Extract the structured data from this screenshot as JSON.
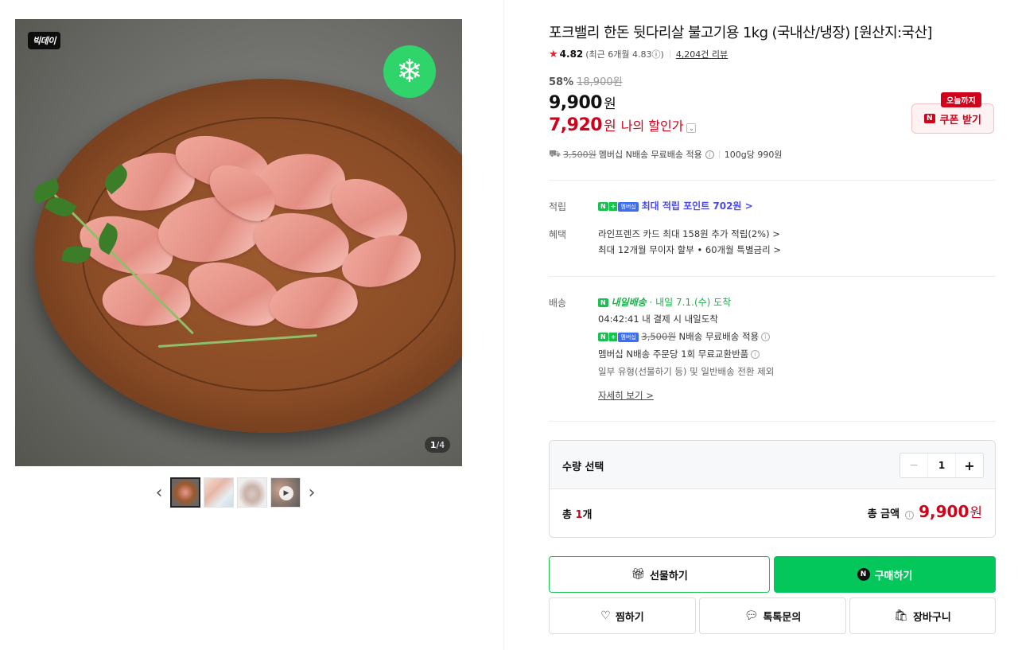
{
  "gallery": {
    "sale_badge": "빅데이",
    "counter_current": "1",
    "counter_total": "4",
    "prev_arrow": "‹",
    "next_arrow": "›"
  },
  "product": {
    "title": "포크밸리 한돈 뒷다리살 불고기용 1kg (국내산/냉장) [원산지:국산]",
    "rating": "4.82",
    "rating_recent": "(최근 6개월 4.83ⓘ)",
    "reviews": "4,204건 리뷰",
    "discount_pct": "58%",
    "original_price": "18,900원",
    "price": "9,900",
    "price_unit": "원",
    "my_price": "7,920",
    "my_price_unit": "원",
    "my_price_label": "나의 할인가",
    "my_price_chevron": "⌄"
  },
  "coupon": {
    "tag": "오늘까지",
    "badge": "N",
    "label": "쿠폰 받기"
  },
  "shipping_summary": {
    "strike_fee": "3,500원",
    "text": "멤버십 N배송 무료배송 적용",
    "unit_price": "100g당 990원"
  },
  "benefits": {
    "points_label": "적립",
    "chip_n": "N",
    "chip_plus": "+",
    "chip_membership": "멤버십",
    "points_text": "최대 적립 포인트 702원 >",
    "benefit_label": "혜택",
    "benefit_line1": "라인프렌즈 카드 최대 158원 추가 적립(2%) >",
    "benefit_line2": "최대 12개월 무이자 할부 • 60개월 특별금리 >"
  },
  "delivery": {
    "label": "배송",
    "badge": "내일배송",
    "arrival": " · 내일 7.1.(수) 도착",
    "line2": "04:42:41  내 결제 시 내일도착",
    "line3_strike": "3,500원",
    "line3": " N배송 무료배송 적용",
    "line4": "멤버십 N배송 주문당 1회 무료교환반품",
    "line5": "일부 유형(선물하기 등) 및 일반배송 전환 제외",
    "details_link": "자세히 보기 >"
  },
  "quantity": {
    "label": "수량 선택",
    "minus": "−",
    "value": "1",
    "plus": "+",
    "total_prefix": "총 ",
    "total_count": "1",
    "total_suffix": "개",
    "total_label": "총 금액",
    "total_amount": "9,900",
    "total_won": "원"
  },
  "actions": {
    "gift": "선물하기",
    "buy": "구매하기",
    "wish": "찜하기",
    "talk": "톡톡문의",
    "cart": "장바구니"
  },
  "colors": {
    "accent_red": "#d0021b",
    "naver_green": "#03c75a",
    "points_purple": "#4a4ae6"
  }
}
